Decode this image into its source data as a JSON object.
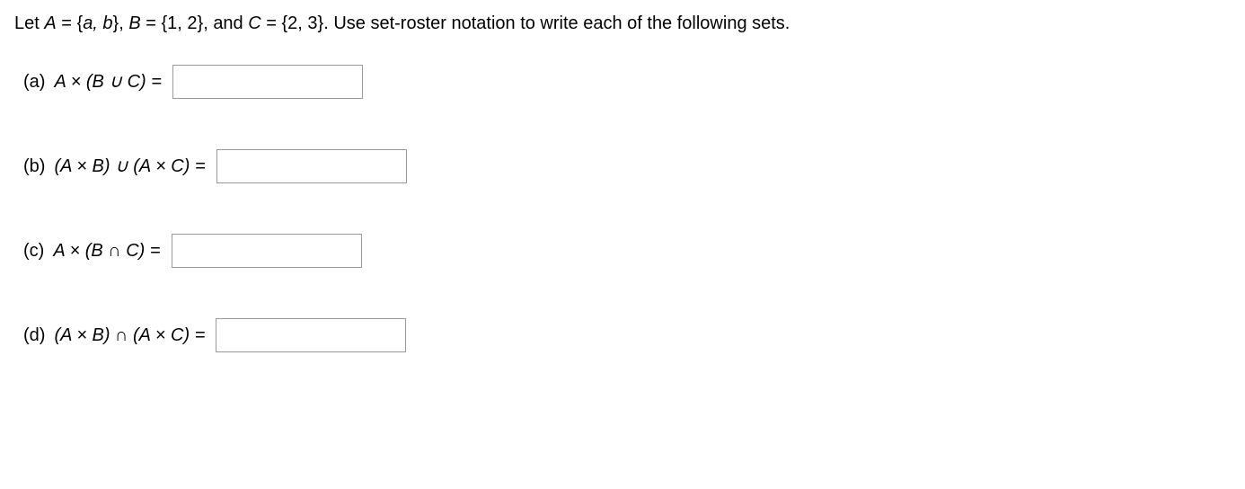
{
  "intro": {
    "pre": "Let ",
    "Aname": "A",
    "Aeq": " = {",
    "Aset": "a, b",
    "closebrace1": "}, ",
    "Bname": "B",
    "Beq": " = {1, 2}, and ",
    "Cname": "C",
    "Ceq": " = {2, 3}. Use set-roster notation to write each of the following sets."
  },
  "questions": {
    "a": {
      "label": "(a)",
      "expr": "A × (B ∪ C) ="
    },
    "b": {
      "label": "(b)",
      "expr": "(A × B) ∪ (A × C) ="
    },
    "c": {
      "label": "(c)",
      "expr": "A × (B ∩ C) ="
    },
    "d": {
      "label": "(d)",
      "expr": "(A × B) ∩ (A × C) ="
    }
  }
}
